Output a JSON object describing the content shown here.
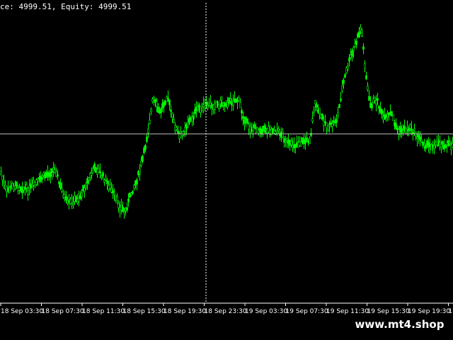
{
  "header": {
    "balance_text": "ce: 4999.51, Equity: 4999.51"
  },
  "time_axis": {
    "labels": [
      "18 Sep 03:30",
      "18 Sep 07:30",
      "18 Sep 11:30",
      "18 Sep 15:30",
      "18 Sep 19:30",
      "18 Sep 23:30",
      "19 Sep 03:30",
      "19 Sep 07:30",
      "19 Sep 11:30",
      "19 Sep 15:30",
      "19 Sep 19:30",
      "19"
    ]
  },
  "colors": {
    "background": "#000000",
    "candle": "#00ff00",
    "grid_line": "#c0c0c0",
    "text": "#ffffff"
  },
  "watermark": {
    "text": "www.mt4.shop"
  }
}
